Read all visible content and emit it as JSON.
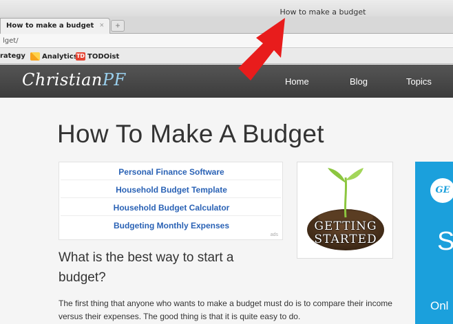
{
  "browser": {
    "window_title": "How to make a budget",
    "tab": {
      "label": "How to make a budget",
      "close": "×"
    },
    "new_tab": "+",
    "url": "lget/",
    "bookmarks": [
      {
        "label": "rategy"
      },
      {
        "label": "Analytics",
        "icon": "analytics-icon"
      },
      {
        "label": "TODOist",
        "icon": "todoist-icon",
        "badge": "TD"
      }
    ]
  },
  "site": {
    "logo_main": "Christian",
    "logo_accent": "PF",
    "nav": [
      "Home",
      "Blog",
      "Topics"
    ]
  },
  "article": {
    "title": "How To Make A Budget",
    "ads": [
      "Personal Finance Software",
      "Household Budget Template",
      "Household Budget Calculator",
      "Budgeting Monthly Expenses"
    ],
    "ad_tag": "ads",
    "image_caption_line1": "GETTING",
    "image_caption_line2": "STARTED",
    "subheading": "What is the best way to start a budget?",
    "paragraph": "The first thing that anyone who wants to make a budget must do is to compare their income versus their expenses. The good thing is that it is quite easy to do."
  },
  "sidebar_ad": {
    "logo": "GE",
    "big_letter": "S",
    "text": "Onl"
  },
  "colors": {
    "link": "#2a62b5",
    "header_bg": "#444444",
    "sidebar_ad_bg": "#1ba0dc",
    "arrow": "#e81c1c"
  }
}
